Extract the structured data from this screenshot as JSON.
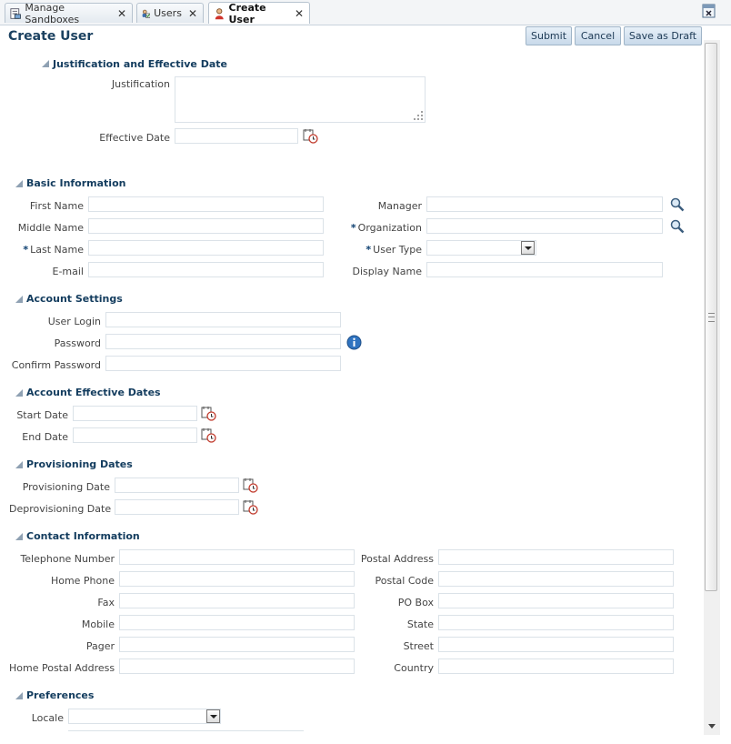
{
  "tabs": [
    {
      "label": "Manage Sandboxes",
      "icon": "sandbox-icon"
    },
    {
      "label": "Users",
      "icon": "users-icon"
    },
    {
      "label": "Create User",
      "icon": "user-icon"
    }
  ],
  "header": {
    "title": "Create User",
    "buttons": {
      "submit": "Submit",
      "cancel": "Cancel",
      "save_draft": "Save as Draft"
    }
  },
  "sections": {
    "justification": {
      "title": "Justification and Effective Date",
      "justification_label": "Justification",
      "effective_date_label": "Effective Date"
    },
    "basic": {
      "title": "Basic Information",
      "first_name": "First Name",
      "middle_name": "Middle Name",
      "last_name": "Last Name",
      "email": "E-mail",
      "manager": "Manager",
      "organization": "Organization",
      "user_type": "User Type",
      "display_name": "Display Name"
    },
    "account": {
      "title": "Account Settings",
      "user_login": "User Login",
      "password": "Password",
      "confirm_password": "Confirm Password"
    },
    "account_dates": {
      "title": "Account Effective Dates",
      "start_date": "Start Date",
      "end_date": "End Date"
    },
    "provisioning": {
      "title": "Provisioning Dates",
      "provisioning_date": "Provisioning Date",
      "deprovisioning_date": "Deprovisioning Date"
    },
    "contact": {
      "title": "Contact Information",
      "telephone": "Telephone Number",
      "home_phone": "Home Phone",
      "fax": "Fax",
      "mobile": "Mobile",
      "pager": "Pager",
      "home_postal_address": "Home Postal Address",
      "postal_address": "Postal Address",
      "postal_code": "Postal Code",
      "po_box": "PO Box",
      "state": "State",
      "street": "Street",
      "country": "Country"
    },
    "preferences": {
      "title": "Preferences",
      "locale": "Locale"
    }
  },
  "required_marker": "*",
  "colors": {
    "section_title": "#133c5e",
    "page_title": "#1b4160",
    "button_bg": "#c8d9ea"
  }
}
